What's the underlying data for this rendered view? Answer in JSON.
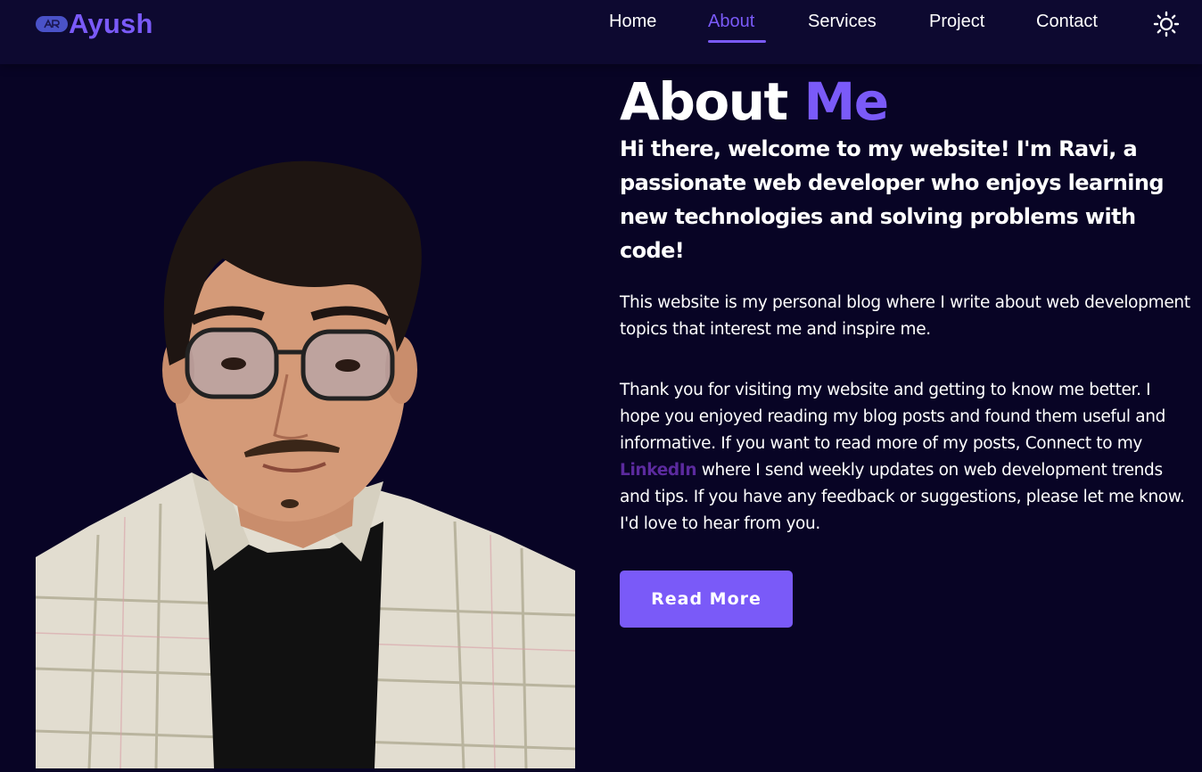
{
  "colors": {
    "accent": "#7a5af8",
    "background": "#080425",
    "navbar": "#0d0930",
    "link": "#5b2a9e"
  },
  "brand": {
    "name": "Ayush",
    "logo_icon": "ar-badge-icon"
  },
  "nav": {
    "items": [
      {
        "label": "Home",
        "active": false
      },
      {
        "label": "About",
        "active": true
      },
      {
        "label": "Services",
        "active": false
      },
      {
        "label": "Project",
        "active": false
      },
      {
        "label": "Contact",
        "active": false
      }
    ],
    "theme_icon": "sun-icon"
  },
  "about": {
    "title_part1": "About",
    "title_part2": "Me",
    "intro": "Hi there, welcome to my website! I'm Ravi, a passionate web developer who enjoys learning new technologies and solving problems with code!",
    "paragraph1": "This website is my personal blog where I write about web development topics that interest me and inspire me.",
    "paragraph2_before": "Thank you for visiting my website and getting to know me better. I hope you enjoyed reading my blog posts and found them useful and informative. If you want to read more of my posts, Connect to my",
    "link_label": "LinkedIn",
    "paragraph2_after": "where I send weekly updates on web development trends and tips. If you have any feedback or suggestions, please let me know. I'd love to hear from you.",
    "button_label": "Read More"
  }
}
